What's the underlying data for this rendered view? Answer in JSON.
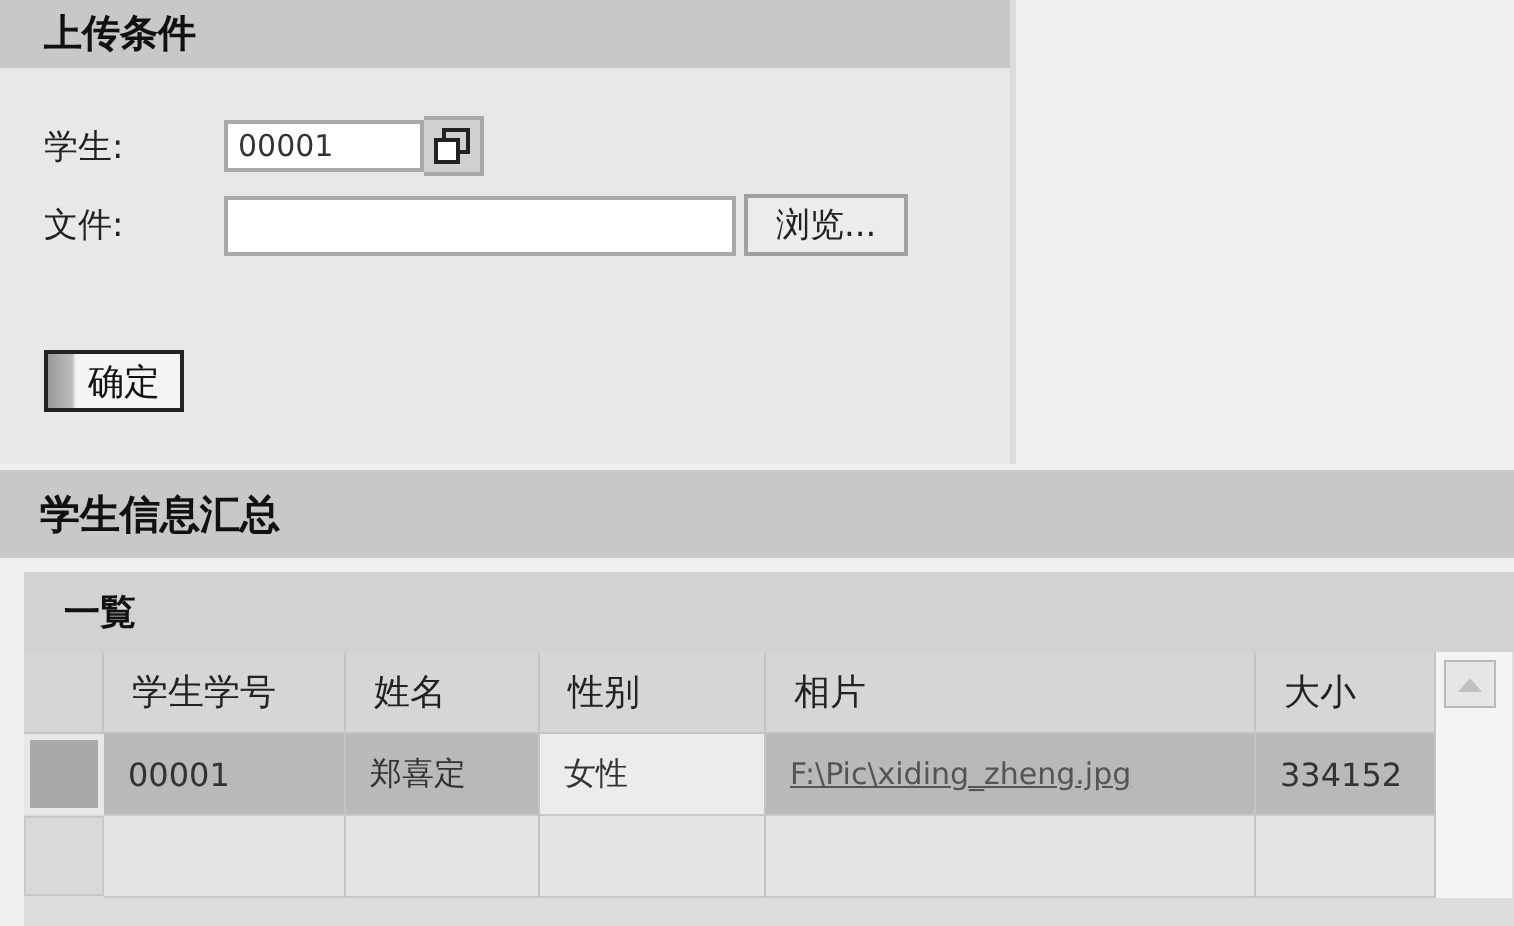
{
  "upload_panel": {
    "title": "上传条件",
    "fields": [
      {
        "kind": "lookup",
        "label": "学生:",
        "value": "00001"
      },
      {
        "kind": "file",
        "label": "文件:",
        "button": "浏览..."
      }
    ],
    "submit": "确定"
  },
  "summary": {
    "title": "学生信息汇总",
    "list": {
      "title": "一覧",
      "columns": [
        "学生学号",
        "姓名",
        "性别",
        "相片",
        "大小"
      ],
      "rows": [
        {
          "selected": true,
          "cells": [
            {
              "kind": "text",
              "text": "00001"
            },
            {
              "kind": "text",
              "text": "郑喜定"
            },
            {
              "kind": "input",
              "text": "女性"
            },
            {
              "kind": "link",
              "text": "F:\\Pic\\xiding_zheng.jpg"
            },
            {
              "kind": "text",
              "text": "334152"
            }
          ]
        },
        {
          "selected": false,
          "cells": [
            {
              "kind": "empty"
            },
            {
              "kind": "empty"
            },
            {
              "kind": "empty"
            },
            {
              "kind": "empty"
            },
            {
              "kind": "empty"
            }
          ]
        }
      ]
    }
  }
}
